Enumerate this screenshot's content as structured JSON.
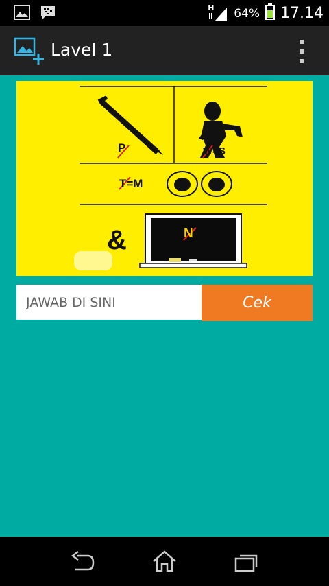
{
  "status_bar": {
    "network_label": "H",
    "battery_percent": "64%",
    "time": "17.14",
    "icons": [
      "gallery-icon",
      "bbm-icon",
      "signal-icon",
      "battery-icon"
    ]
  },
  "action_bar": {
    "title": "Lavel 1",
    "icons": [
      "add-image-icon",
      "overflow-menu-icon"
    ]
  },
  "puzzle": {
    "cell_texts": [
      "P",
      "W=S",
      "T=M",
      "&",
      "N"
    ]
  },
  "answer": {
    "placeholder": "JAWAB DI SINI",
    "value": ""
  },
  "check_button": {
    "label": "Cek"
  },
  "nav_bar": {
    "icons": [
      "back-icon",
      "home-icon",
      "recent-apps-icon"
    ]
  },
  "colors": {
    "content_bg": "#00aba2",
    "button_bg": "#f07a22",
    "puzzle_bg": "#ffee00",
    "action_bar_bg": "#222222",
    "accent_blue": "#33b5e5"
  }
}
